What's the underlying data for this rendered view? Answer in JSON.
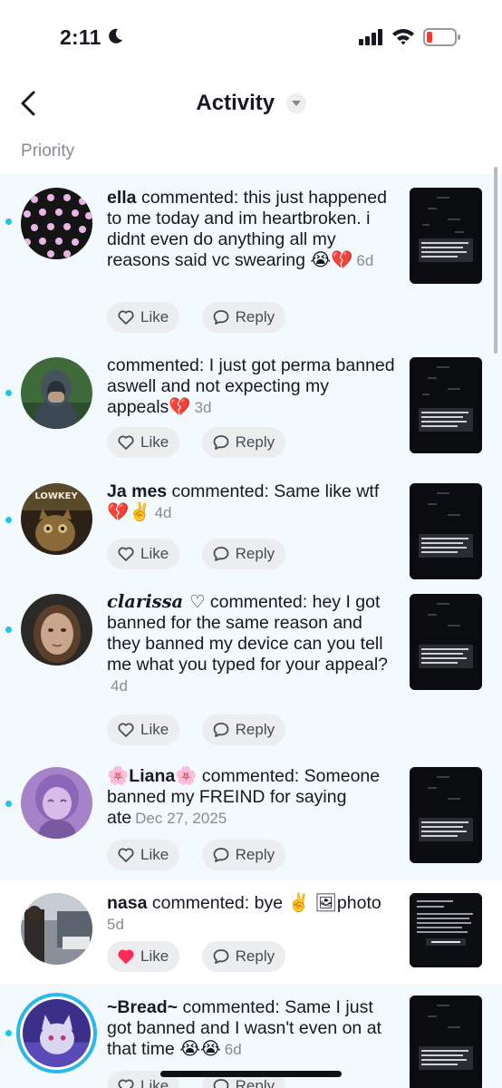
{
  "status_bar": {
    "time": "2:11"
  },
  "header": {
    "title": "Activity"
  },
  "section": {
    "label": "Priority"
  },
  "items": [
    {
      "name": "ella",
      "verb": " commented: ",
      "text": "this just happened to me today and im heartbroken. i didnt even do anything all my reasons said vc swearing 😭💔",
      "age": "6d",
      "like_label": "Like",
      "reply_label": "Reply",
      "liked": false,
      "unread": true,
      "avatar": "polka-dot-avatar"
    },
    {
      "name": "",
      "verb": " commented: ",
      "text": "I just got perma banned aswell and not expecting my appeals💔",
      "age": "3d",
      "like_label": "Like",
      "reply_label": "Reply",
      "liked": false,
      "unread": true,
      "avatar": "hooded-person-avatar"
    },
    {
      "name": "Ja mes",
      "verb": " commented: ",
      "text": "Same like wtf 💔✌️",
      "age": "4d",
      "like_label": "Like",
      "reply_label": "Reply",
      "liked": false,
      "unread": true,
      "avatar": "cat-lowkey-avatar"
    },
    {
      "name": "𝒄𝒍𝒂𝒓𝒊𝒔𝒔𝒂 ♡",
      "verb": " commented: ",
      "text": "hey I got banned for the same reason and they banned my device can you tell me what you typed for your appeal?",
      "age": "4d",
      "like_label": "Like",
      "reply_label": "Reply",
      "liked": false,
      "unread": true,
      "avatar": "girl-portrait-avatar"
    },
    {
      "name": "🌸Liana🌸",
      "verb": " commented: ",
      "text": "Someone banned my FREIND for saying ate",
      "age": "Dec 27, 2025",
      "like_label": "Like",
      "reply_label": "Reply",
      "liked": false,
      "unread": true,
      "avatar": "purple-anime-avatar"
    },
    {
      "name": "nasa",
      "verb": " commented: ",
      "text": "bye ✌️ 🖼photo",
      "age": "5d",
      "like_label": "Like",
      "reply_label": "Reply",
      "liked": true,
      "unread": false,
      "avatar": "street-photo-avatar"
    },
    {
      "name": "~Bread~",
      "verb": " commented: ",
      "text": "Same I just got banned and I wasn't even on at that time 😭😭",
      "age": "6d",
      "like_label": "Like",
      "reply_label": "Reply",
      "liked": false,
      "unread": true,
      "avatar": "anime-cat-avatar"
    }
  ],
  "colors": {
    "unread_bg": "#f2fafd",
    "unread_dot": "#20c4e4",
    "liked_heart": "#fe2c55"
  },
  "icons": [
    "back-arrow-icon",
    "dropdown-caret-icon",
    "heart-icon",
    "comment-bubble-icon",
    "moon-icon",
    "signal-icon",
    "wifi-icon",
    "battery-icon"
  ]
}
